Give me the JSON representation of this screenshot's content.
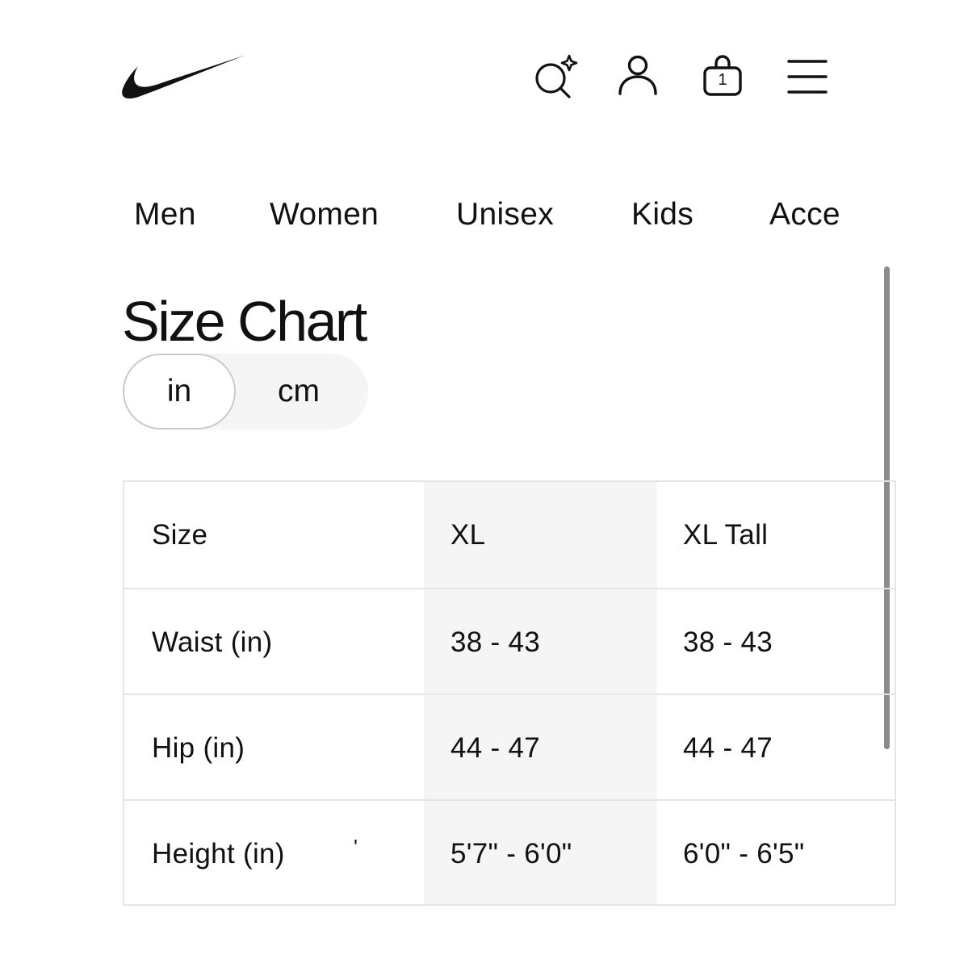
{
  "header": {
    "logo_icon": "swoosh-logo-icon",
    "icons": [
      "ai-search-icon",
      "account-icon",
      "bag-icon",
      "menu-icon"
    ],
    "bag_count": "1"
  },
  "categories": [
    "Men",
    "Women",
    "Unisex",
    "Kids",
    "Acce"
  ],
  "title": "Size Chart",
  "unit_toggle": {
    "options": [
      "in",
      "cm"
    ],
    "selected": "in"
  },
  "table": {
    "header": {
      "label": "Size",
      "col1": "XL",
      "col2": "XL Tall"
    },
    "rows": [
      {
        "label": "Waist (in)",
        "col1": "38 - 43",
        "col2": "38 - 43"
      },
      {
        "label": "Hip (in)",
        "col1": "44 - 47",
        "col2": "44 - 47"
      },
      {
        "label": "Height (in)",
        "mark": "'",
        "col1": "5'7\" - 6'0\"",
        "col2": "6'0\" - 6'5\""
      }
    ]
  },
  "colors": {
    "text": "#111111",
    "background": "#ffffff",
    "shaded_column": "#f5f5f5",
    "border": "#e5e5e5",
    "scrollbar": "#8b8b8b"
  }
}
